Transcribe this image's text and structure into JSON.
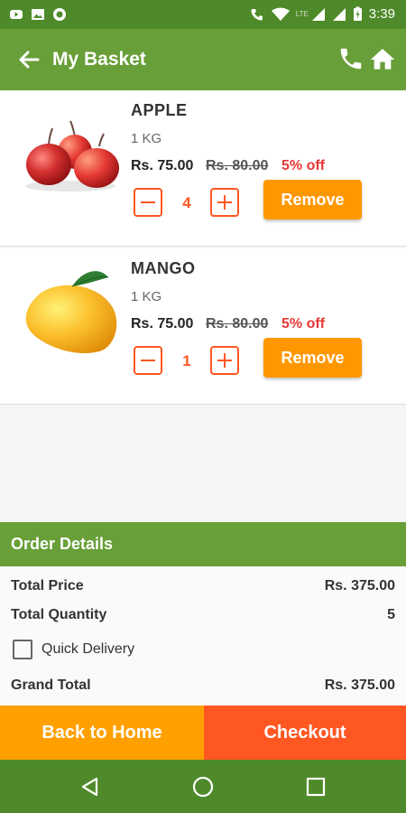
{
  "status_bar": {
    "time": "3:39",
    "network": "LTE"
  },
  "app_bar": {
    "title": "My Basket"
  },
  "basket": {
    "items": [
      {
        "name": "APPLE",
        "unit": "1 KG",
        "price": "Rs. 75.00",
        "mrp": "Rs. 80.00",
        "discount": "5% off",
        "quantity": "4",
        "remove_label": "Remove"
      },
      {
        "name": "MANGO",
        "unit": "1 KG",
        "price": "Rs. 75.00",
        "mrp": "Rs. 80.00",
        "discount": "5% off",
        "quantity": "1",
        "remove_label": "Remove"
      }
    ]
  },
  "order_details": {
    "header": "Order Details",
    "total_price_label": "Total Price",
    "total_price_value": "Rs. 375.00",
    "total_quantity_label": "Total Quantity",
    "total_quantity_value": "5",
    "quick_delivery_label": "Quick Delivery",
    "quick_delivery_checked": false,
    "grand_total_label": "Grand Total",
    "grand_total_value": "Rs. 375.00"
  },
  "actions": {
    "back_home_label": "Back to Home",
    "checkout_label": "Checkout"
  },
  "colors": {
    "primary": "#689f38",
    "primary_dark": "#4e8a29",
    "accent_orange": "#ff9800",
    "accent_deep_orange": "#ff5722",
    "discount_red": "#e53935"
  }
}
